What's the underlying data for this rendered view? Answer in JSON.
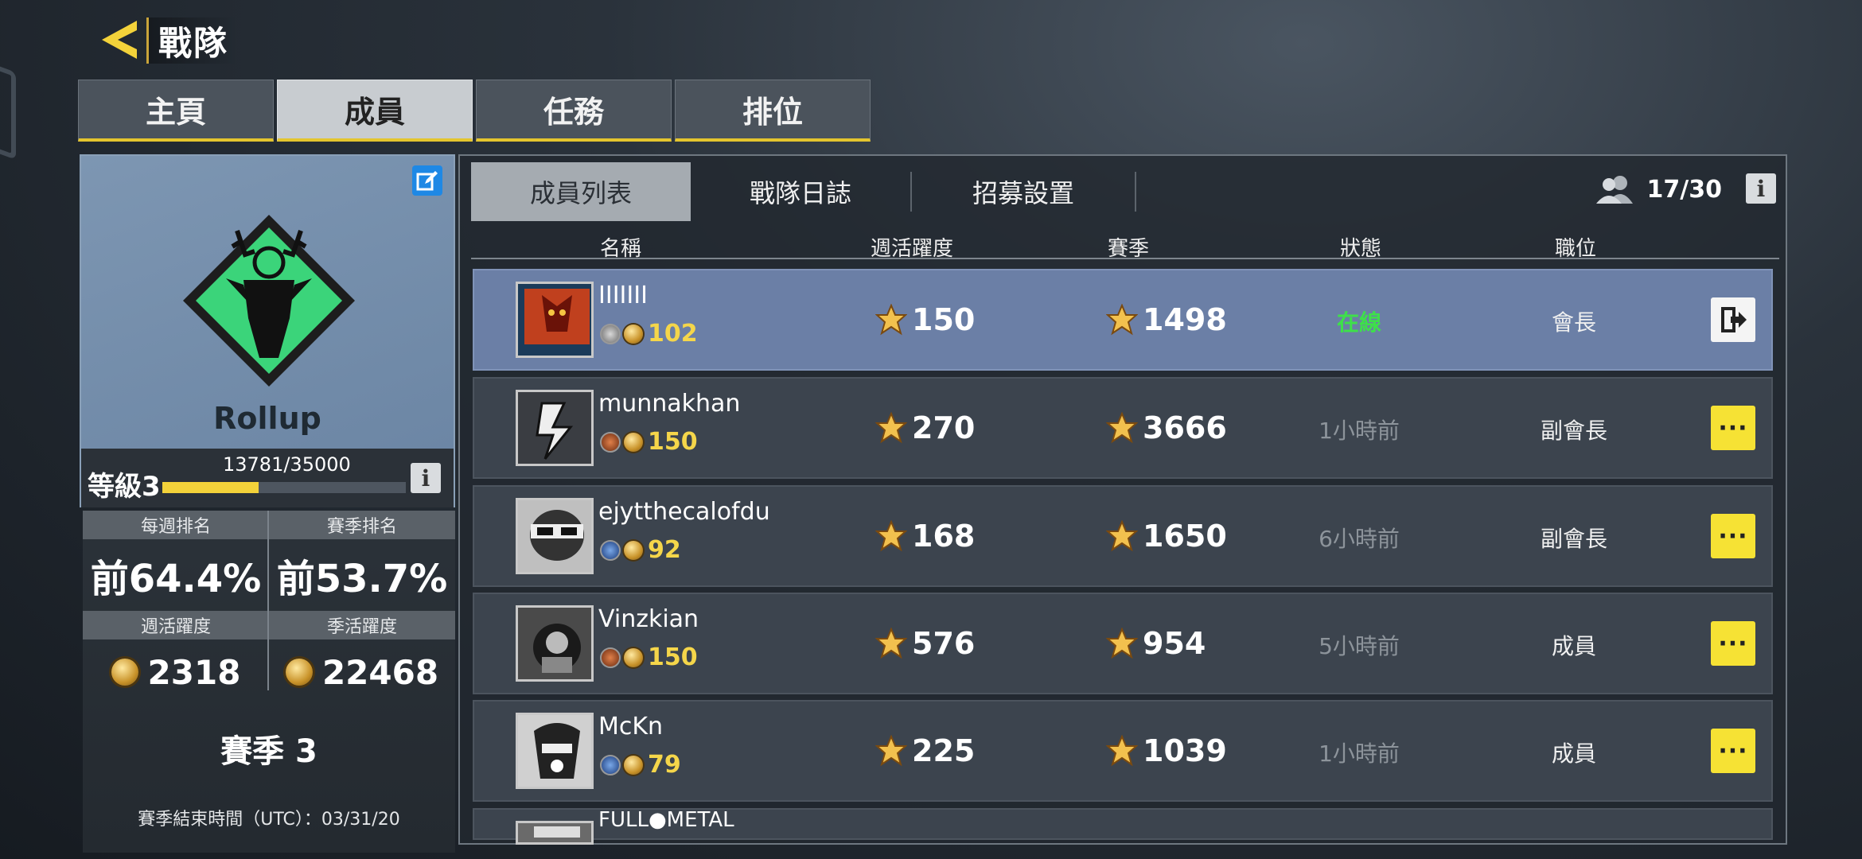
{
  "header": {
    "title": "戰隊"
  },
  "tabs": [
    {
      "label": "主頁",
      "active": false
    },
    {
      "label": "成員",
      "active": true
    },
    {
      "label": "任務",
      "active": false
    },
    {
      "label": "排位",
      "active": false
    }
  ],
  "clan": {
    "name": "Rollup",
    "level_label": "等級3",
    "xp_text": "13781/35000",
    "xp_progress": 0.394,
    "stats": {
      "weekly_rank_label": "每週排名",
      "weekly_rank": "前64.4%",
      "season_rank_label": "賽季排名",
      "season_rank": "前53.7%",
      "weekly_activity_label": "週活躍度",
      "weekly_activity": "2318",
      "season_activity_label": "季活躍度",
      "season_activity": "22468"
    },
    "season": "賽季 3",
    "season_end": "賽季結束時間（UTC）：03/31/20"
  },
  "subtabs": [
    {
      "label": "成員列表",
      "active": true
    },
    {
      "label": "戰隊日誌",
      "active": false
    },
    {
      "label": "招募設置",
      "active": false
    }
  ],
  "member_count": "17/30",
  "columns": {
    "name": "名稱",
    "weekly": "週活躍度",
    "season": "賽季",
    "status": "狀態",
    "role": "職位"
  },
  "members": [
    {
      "name": "IIIIIII",
      "level": "102",
      "weekly": "150",
      "season": "1498",
      "status": "在線",
      "online": true,
      "role": "會長",
      "action": "exit"
    },
    {
      "name": "munnakhan",
      "level": "150",
      "weekly": "270",
      "season": "3666",
      "status": "1小時前",
      "online": false,
      "role": "副會長",
      "action": "more"
    },
    {
      "name": "ejytthecalofdu",
      "level": "92",
      "weekly": "168",
      "season": "1650",
      "status": "6小時前",
      "online": false,
      "role": "副會長",
      "action": "more"
    },
    {
      "name": "Vinzkian",
      "level": "150",
      "weekly": "576",
      "season": "954",
      "status": "5小時前",
      "online": false,
      "role": "成員",
      "action": "more"
    },
    {
      "name": "McKn",
      "level": "79",
      "weekly": "225",
      "season": "1039",
      "status": "1小時前",
      "online": false,
      "role": "成員",
      "action": "more"
    },
    {
      "name": "FULL●METAL",
      "partial": true
    }
  ],
  "more_label": "···",
  "colors": {
    "accent": "#f6e234",
    "online": "#3ee04a",
    "level": "#f5d64a",
    "selected_row": "#6b7fa6"
  }
}
